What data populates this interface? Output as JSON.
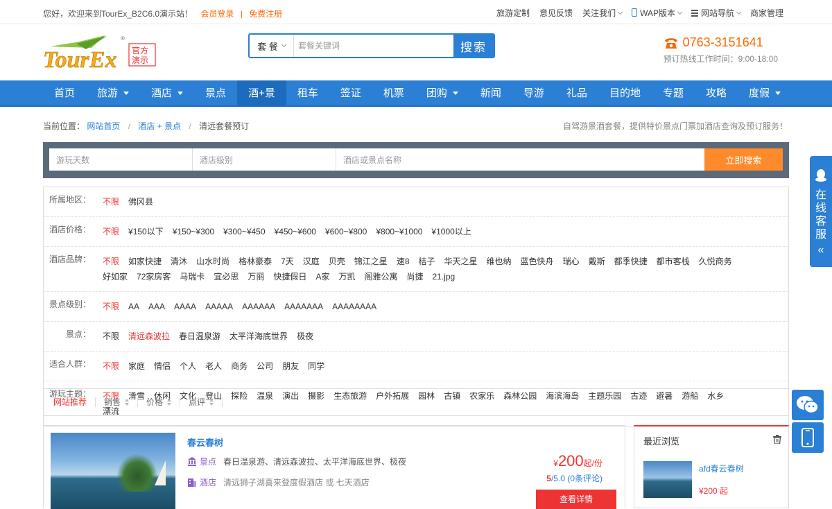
{
  "topbar": {
    "welcome": "您好，欢迎来到TourEx_B2C6.0演示站！",
    "login": "会员登录",
    "sep": "|",
    "register": "免费注册",
    "links": [
      "旅游定制",
      "意见反馈",
      "关注我们",
      "WAP版本",
      "网站导航",
      "商家管理"
    ]
  },
  "logo": {
    "text": "TourEx",
    "badge_top": "官方",
    "badge_bottom": "演示",
    "reg": "®"
  },
  "search": {
    "category": "套 餐",
    "placeholder": "套餐关键词",
    "button": "搜索"
  },
  "hotline": {
    "number": "0763-3151641",
    "hours": "预订热线工作时间：9:00-18:00"
  },
  "nav": {
    "items": [
      "首页",
      "旅游",
      "酒店",
      "景点",
      "酒+景",
      "租车",
      "签证",
      "机票",
      "团购",
      "新闻",
      "导游",
      "礼品",
      "目的地",
      "专题",
      "攻略",
      "度假"
    ]
  },
  "crumb": {
    "label": "当前位置：",
    "home": "网站首页",
    "sl1": "/",
    "section": "酒店 + 景点",
    "sl2": "/",
    "current": "清远套餐预订",
    "tagline": "自驾游景酒套餐，提供特价景点门票加酒店查询及预订服务！"
  },
  "searchbox": {
    "days_placeholder": "游玩天数",
    "level_placeholder": "酒店级别",
    "name_placeholder": "酒店或景点名称",
    "button": "立即搜索"
  },
  "filters": [
    {
      "label": "所属地区：",
      "values": [
        "不限",
        "佛冈县"
      ],
      "selected": 0
    },
    {
      "label": "酒店价格：",
      "values": [
        "不限",
        "¥150以下",
        "¥150~¥300",
        "¥300~¥450",
        "¥450~¥600",
        "¥600~¥800",
        "¥800~¥1000",
        "¥1000以上"
      ],
      "selected": 0
    },
    {
      "label": "酒店品牌：",
      "values": [
        "不限",
        "如家快捷",
        "清沐",
        "山水时尚",
        "格林豪泰",
        "7天",
        "汉庭",
        "贝壳",
        "锦江之星",
        "速8",
        "桔子",
        "华天之星",
        "维也纳",
        "蓝色快舟",
        "瑞心",
        "戴斯",
        "都季快捷",
        "都市客栈",
        "久悦商务",
        "好如家",
        "72家房客",
        "马瑞卡",
        "宜必思",
        "万丽",
        "快捷假日",
        "A家",
        "万凯",
        "阁雅公寓",
        "尚捷",
        "21.jpg"
      ],
      "selected": 0
    },
    {
      "label": "景点级别：",
      "values": [
        "不限",
        "AA",
        "AAA",
        "AAAA",
        "AAAAA",
        "AAAAAA",
        "AAAAAAA",
        "AAAAAAAA"
      ],
      "selected": 0
    },
    {
      "label": "景点：",
      "values": [
        "不限",
        "清远森波拉",
        "春日温泉游",
        "太平洋海底世界",
        "极夜"
      ],
      "selected": 1
    },
    {
      "label": "适合人群：",
      "values": [
        "不限",
        "家庭",
        "情侣",
        "个人",
        "老人",
        "商务",
        "公司",
        "朋友",
        "同学"
      ],
      "selected": 0
    },
    {
      "label": "游玩主题：",
      "values": [
        "不限",
        "滑雪",
        "休闲",
        "文化",
        "登山",
        "探险",
        "温泉",
        "演出",
        "摄影",
        "生态旅游",
        "户外拓展",
        "园林",
        "古镇",
        "农家乐",
        "森林公园",
        "海滨海岛",
        "主题乐园",
        "古迹",
        "避暑",
        "游船",
        "水乡",
        "漂流"
      ],
      "selected": 0
    }
  ],
  "sort": {
    "items": [
      "网站推荐",
      "销售",
      "价格",
      "点评"
    ]
  },
  "product": {
    "name": "春云春树",
    "scenic_tag": "景点",
    "scenic": "春日温泉游、清远森波拉、太平洋海底世界、极夜",
    "hotel_tag": "酒店",
    "hotel": "清远狮子湖喜来登度假酒店 或 七天酒店",
    "price_yen": "¥",
    "price": "200",
    "price_unit": "起/份",
    "rating": "5",
    "rating_rest": "/5.0 (0条评论)",
    "button": "查看详情"
  },
  "recent": {
    "title": "最近浏览",
    "name": "afd春云春树",
    "price": "¥200",
    "price_unit": "起"
  },
  "kefu": {
    "text": [
      "在",
      "线",
      "客",
      "服"
    ],
    "chev": "«"
  },
  "colors": {
    "primary": "#2b7fd4",
    "accent": "#ff8a2b",
    "red": "#e33",
    "orange": "#f60"
  }
}
